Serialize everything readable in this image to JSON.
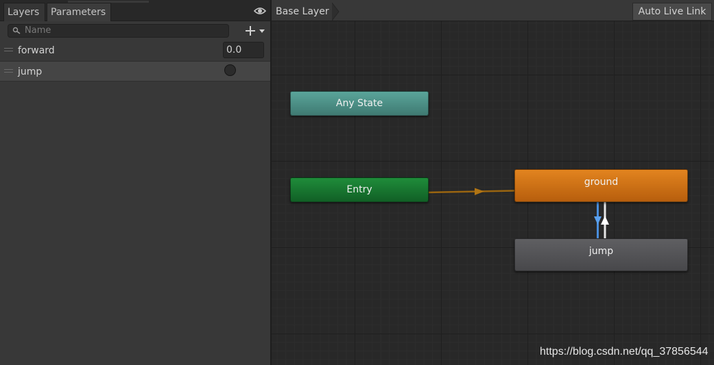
{
  "tabs": [
    {
      "label": "Layers"
    },
    {
      "label": "Parameters"
    }
  ],
  "search": {
    "placeholder": "Name"
  },
  "parameters": [
    {
      "name": "forward",
      "type": "float",
      "value": "0.0"
    },
    {
      "name": "jump",
      "type": "bool",
      "value": false
    }
  ],
  "graph": {
    "breadcrumb": "Base Layer",
    "auto_live_link_label": "Auto Live Link",
    "states": {
      "any_state": "Any State",
      "entry": "Entry",
      "ground": "ground",
      "jump": "jump"
    },
    "colors": {
      "any_state": "#4f9188",
      "entry": "#18772f",
      "ground": "#d07216",
      "jump": "#545457",
      "entry_transition": "#a06a10",
      "selected_transition": "#4a8edc",
      "transition": "#e6e6e6"
    }
  },
  "icons": {
    "visibility": "eye-icon",
    "search": "search-icon",
    "add": "plus-icon",
    "dropdown": "chevron-down-icon"
  },
  "watermark": "https://blog.csdn.net/qq_37856544"
}
